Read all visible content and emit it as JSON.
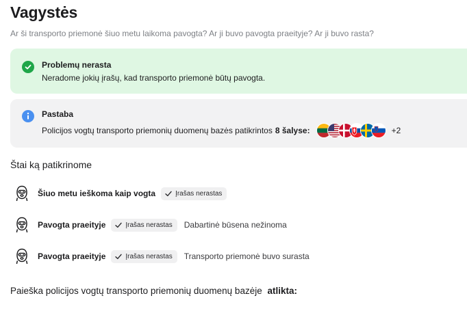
{
  "page": {
    "title": "Vagystės",
    "subtitle": "Ar ši transporto priemonė šiuo metu laikoma pavogta? Ar ji buvo pavogta praeityje? Ar ji buvo rasta?"
  },
  "status_card": {
    "title": "Problemų nerasta",
    "text": "Neradome jokių įrašų, kad transporto priemonė būtų pavogta.",
    "icon": "check-circle-icon",
    "color": "#1fa649",
    "background": "#dff7e3"
  },
  "note_card": {
    "title": "Pastaba",
    "text_prefix": "Policijos vogtų transporto priemonių duomenų bazės patikrintos",
    "text_bold": "8 šalyse:",
    "icon": "info-circle-icon",
    "color": "#4a90f0",
    "flags": [
      "lithuania-flag-icon",
      "usa-flag-icon",
      "denmark-flag-icon",
      "slovakia-flag-icon",
      "sweden-flag-icon",
      "slovenia-flag-icon"
    ],
    "more": "+2"
  },
  "checks": {
    "heading": "Štai ką patikrinome",
    "rows": [
      {
        "label": "Šiuo metu ieškoma kaip vogta",
        "badge": "Įrašas nerastas",
        "extra": ""
      },
      {
        "label": "Pavogta praeityje",
        "badge": "Įrašas nerastas",
        "extra": "Dabartinė būsena nežinoma"
      },
      {
        "label": "Pavogta praeityje",
        "badge": "Įrašas nerastas",
        "extra": "Transporto priemonė buvo surasta"
      }
    ]
  },
  "footer": {
    "text": "Paieška policijos vogtų transporto priemonių duomenų bazėje",
    "bold": "atlikta:"
  }
}
